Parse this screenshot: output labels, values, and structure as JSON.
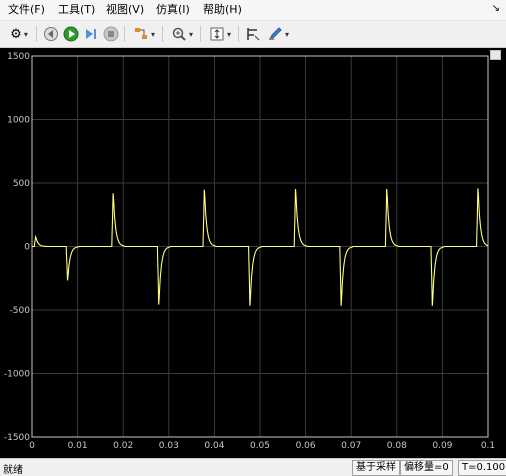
{
  "menu": [
    "文件(F)",
    "工具(T)",
    "视图(V)",
    "仿真(I)",
    "帮助(H)"
  ],
  "toolbar": {
    "icons": [
      "gear-icon",
      "rewind-icon",
      "run-icon",
      "step-forward-icon",
      "stop-icon",
      "signal-select-icon",
      "zoom-in-icon",
      "autoscale-icon",
      "cursor-measure-icon",
      "style-icon"
    ]
  },
  "colors": {
    "plot_bg": "#000000",
    "trace": "#ffff7a",
    "axis": "#c8c8c8",
    "grid": "#3a3a3a"
  },
  "chart_data": {
    "type": "line",
    "title": "",
    "xlabel": "",
    "ylabel": "",
    "xlim": [
      0,
      0.1
    ],
    "ylim": [
      -1500,
      1500
    ],
    "xticks": [
      "0",
      "0.01",
      "0.02",
      "0.03",
      "0.04",
      "0.05",
      "0.06",
      "0.07",
      "0.08",
      "0.09",
      "0.1"
    ],
    "yticks": [
      "1500",
      "1000",
      "500",
      "0",
      "-500",
      "-1000",
      "-1500"
    ],
    "grid": true,
    "series": [
      {
        "spikes": [
          {
            "t": 0.0008,
            "peak": 80
          },
          {
            "t": 0.0078,
            "peak": -280
          },
          {
            "t": 0.0178,
            "peak": 440
          },
          {
            "t": 0.0278,
            "peak": -480
          },
          {
            "t": 0.0378,
            "peak": 470
          },
          {
            "t": 0.0478,
            "peak": -490
          },
          {
            "t": 0.0578,
            "peak": 475
          },
          {
            "t": 0.0678,
            "peak": -490
          },
          {
            "t": 0.0778,
            "peak": 475
          },
          {
            "t": 0.0878,
            "peak": -490
          },
          {
            "t": 0.0978,
            "peak": 480
          }
        ]
      }
    ]
  },
  "status": {
    "left": "就绪",
    "mode": "基于采样",
    "offset": "偏移量=0",
    "time": "T=0.100"
  }
}
